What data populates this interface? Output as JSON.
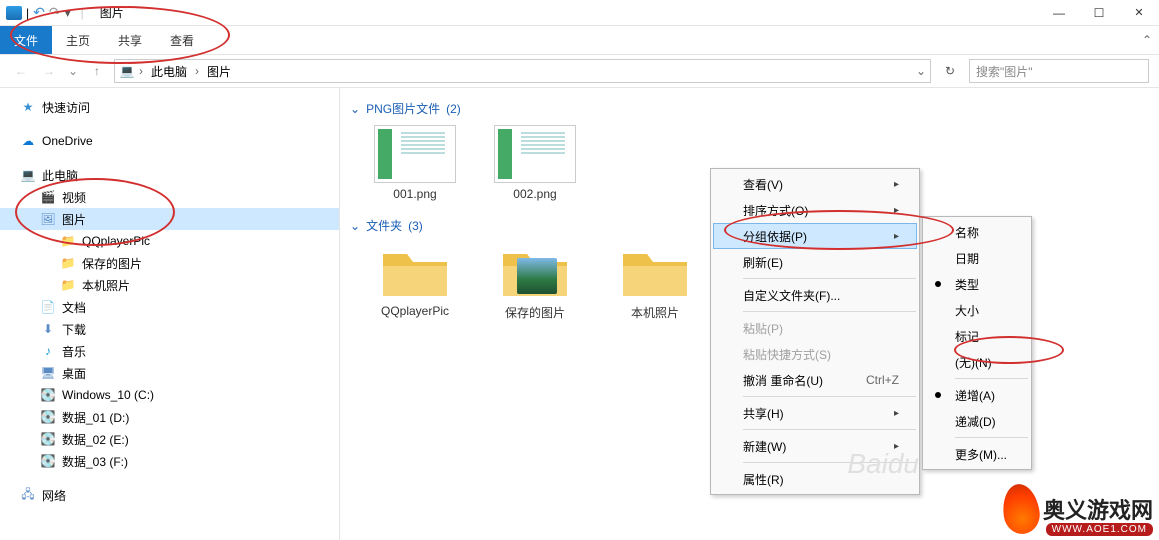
{
  "titlebar": {
    "sep": "|",
    "undo": "↶",
    "redo": "↷",
    "down": "▾",
    "title": "图片"
  },
  "winbtns": {
    "min": "—",
    "max": "☐",
    "close": "✕"
  },
  "tabs": {
    "file": "文件",
    "home": "主页",
    "share": "共享",
    "view": "查看",
    "expand": "⌃"
  },
  "nav": {
    "back": "←",
    "fwd": "→",
    "up": "↑",
    "dropdown": "⌄",
    "refresh": "↻"
  },
  "breadcrumb": {
    "root_icon": "💻",
    "root": "此电脑",
    "sep": "›",
    "current": "图片",
    "address_dropdown": "⌄"
  },
  "search": {
    "placeholder": "搜索\"图片\""
  },
  "sidebar": {
    "quick": "快速访问",
    "onedrive": "OneDrive",
    "thispc": "此电脑",
    "video": "视频",
    "pictures": "图片",
    "qqpic": "QQplayerPic",
    "saved": "保存的图片",
    "camera": "本机照片",
    "docs": "文档",
    "downloads": "下载",
    "music": "音乐",
    "desktop": "桌面",
    "drive_c": "Windows_10 (C:)",
    "drive_d": "数据_01 (D:)",
    "drive_e": "数据_02 (E:)",
    "drive_f": "数据_03 (F:)",
    "network": "网络"
  },
  "groups": {
    "png": {
      "label": "PNG图片文件",
      "count": "(2)"
    },
    "folder": {
      "label": "文件夹",
      "count": "(3)"
    },
    "chev": "⌄"
  },
  "files": {
    "f1": "001.png",
    "f2": "002.png",
    "d1": "QQplayerPic",
    "d2": "保存的图片",
    "d3": "本机照片"
  },
  "ctx": {
    "view": "查看(V)",
    "sort": "排序方式(O)",
    "group": "分组依据(P)",
    "refresh": "刷新(E)",
    "custom": "自定义文件夹(F)...",
    "paste": "粘贴(P)",
    "paste_sc": "粘贴快捷方式(S)",
    "undo_rename": "撤消 重命名(U)",
    "undo_key": "Ctrl+Z",
    "share": "共享(H)",
    "new": "新建(W)",
    "props": "属性(R)",
    "arrow": "▸"
  },
  "sub": {
    "name": "名称",
    "date": "日期",
    "type": "类型",
    "size": "大小",
    "tag": "标记",
    "none": "(无)(N)",
    "asc": "递增(A)",
    "desc": "递减(D)",
    "more": "更多(M)..."
  },
  "watermark": {
    "brand": "奥义游戏网",
    "url": "WWW.AOE1.COM",
    "faint": "Baidu"
  }
}
